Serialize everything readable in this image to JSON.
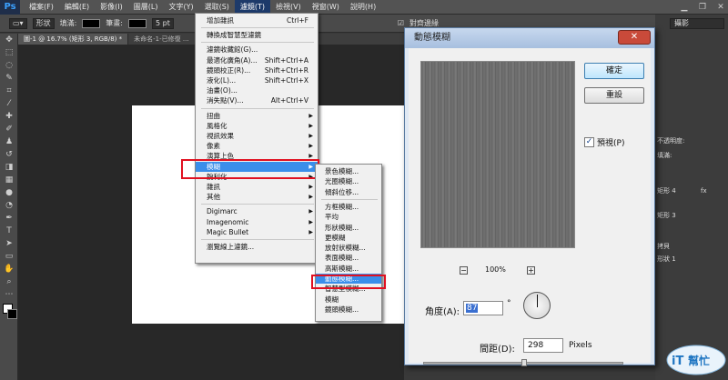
{
  "menubar": {
    "logo": "Ps",
    "items": [
      "檔案(F)",
      "編輯(E)",
      "影像(I)",
      "圖層(L)",
      "文字(Y)",
      "選取(S)",
      "濾鏡(T)",
      "檢視(V)",
      "視窗(W)",
      "說明(H)"
    ],
    "active_index": 6
  },
  "options": {
    "shape": "形狀",
    "fill": "填滿:",
    "stroke": "筆畫:",
    "stroke_size": "5 pt",
    "align_edges": "對齊邊緣"
  },
  "doc_tabs": [
    "圖-1 @ 16.7% (矩形 3, RGB/8) *",
    "未命名-1-已修復 ..."
  ],
  "workspace": "攝影",
  "right_panel": {
    "opacity_label": "不透明度:",
    "fill_label": "填滿:",
    "layer_labels": [
      "矩形 4",
      "fx",
      "矩形 3",
      "拷貝",
      "形狀 1"
    ]
  },
  "filter_menu": {
    "items": [
      {
        "label": "增加雜訊",
        "shortcut": "Ctrl+F"
      },
      {
        "sep": true
      },
      {
        "label": "轉換成智慧型濾鏡"
      },
      {
        "sep": true
      },
      {
        "label": "濾鏡收藏館(G)..."
      },
      {
        "label": "最適化廣角(A)...",
        "shortcut": "Shift+Ctrl+A"
      },
      {
        "label": "鏡頭校正(R)...",
        "shortcut": "Shift+Ctrl+R"
      },
      {
        "label": "液化(L)...",
        "shortcut": "Shift+Ctrl+X"
      },
      {
        "label": "油畫(O)..."
      },
      {
        "label": "消失點(V)...",
        "shortcut": "Alt+Ctrl+V"
      },
      {
        "sep": true
      },
      {
        "label": "扭曲",
        "submenu": true
      },
      {
        "label": "風格化",
        "submenu": true
      },
      {
        "label": "視訊效果",
        "submenu": true
      },
      {
        "label": "像素",
        "submenu": true
      },
      {
        "label": "演算上色",
        "submenu": true
      },
      {
        "label": "模糊",
        "submenu": true,
        "highlight": true
      },
      {
        "label": "銳利化",
        "submenu": true
      },
      {
        "label": "雜訊",
        "submenu": true
      },
      {
        "label": "其他",
        "submenu": true
      },
      {
        "sep": true
      },
      {
        "label": "Digimarc",
        "submenu": true
      },
      {
        "label": "Imagenomic",
        "submenu": true
      },
      {
        "label": "Magic Bullet",
        "submenu": true
      },
      {
        "sep": true
      },
      {
        "label": "瀏覽線上濾鏡..."
      }
    ]
  },
  "blur_submenu": {
    "items": [
      {
        "label": "景色模糊..."
      },
      {
        "label": "光圈模糊..."
      },
      {
        "label": "傾斜位移..."
      },
      {
        "sep": true
      },
      {
        "label": "方框模糊..."
      },
      {
        "label": "平均"
      },
      {
        "label": "形狀模糊..."
      },
      {
        "label": "更模糊"
      },
      {
        "label": "放射狀模糊..."
      },
      {
        "label": "表面模糊..."
      },
      {
        "label": "高斯模糊..."
      },
      {
        "label": "動態模糊...",
        "highlight": true
      },
      {
        "label": "智慧型模糊..."
      },
      {
        "label": "模糊"
      },
      {
        "label": "鏡頭模糊..."
      }
    ]
  },
  "dialog": {
    "title": "動態模糊",
    "close": "✕",
    "ok": "確定",
    "reset": "重設",
    "preview_label": "預視(P)",
    "preview_checked": true,
    "zoom_minus": "−",
    "zoom_plus": "+",
    "zoom": "100%",
    "angle_label": "角度(A):",
    "angle_value": "87",
    "degree_symbol": "°",
    "distance_label": "間距(D):",
    "distance_value": "298",
    "distance_unit": "Pixels"
  },
  "watermark": {
    "brand": "iT邦",
    "sub": "幫忙"
  }
}
